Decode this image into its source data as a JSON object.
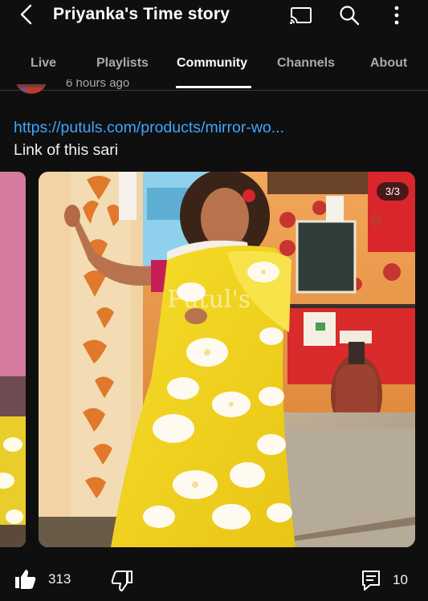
{
  "header": {
    "title": "Priyanka's Time story",
    "icons": [
      "back-arrow-icon",
      "cast-icon",
      "search-icon",
      "more-vert-icon"
    ]
  },
  "tabs": [
    {
      "label": "Live",
      "active": false
    },
    {
      "label": "Playlists",
      "active": false
    },
    {
      "label": "Community",
      "active": true
    },
    {
      "label": "Channels",
      "active": false
    },
    {
      "label": "About",
      "active": false
    }
  ],
  "post": {
    "meta": "6 hours ago",
    "link": "https://putuls.com/products/mirror-wo...",
    "text": "Link of this sari",
    "image_counter": "3/3",
    "watermark": "Putul's"
  },
  "actions": {
    "likes": "313",
    "comments": "10"
  },
  "colors": {
    "background": "#0f0f0f",
    "link": "#3ea6ff",
    "saree_yellow": "#f2d21a"
  }
}
